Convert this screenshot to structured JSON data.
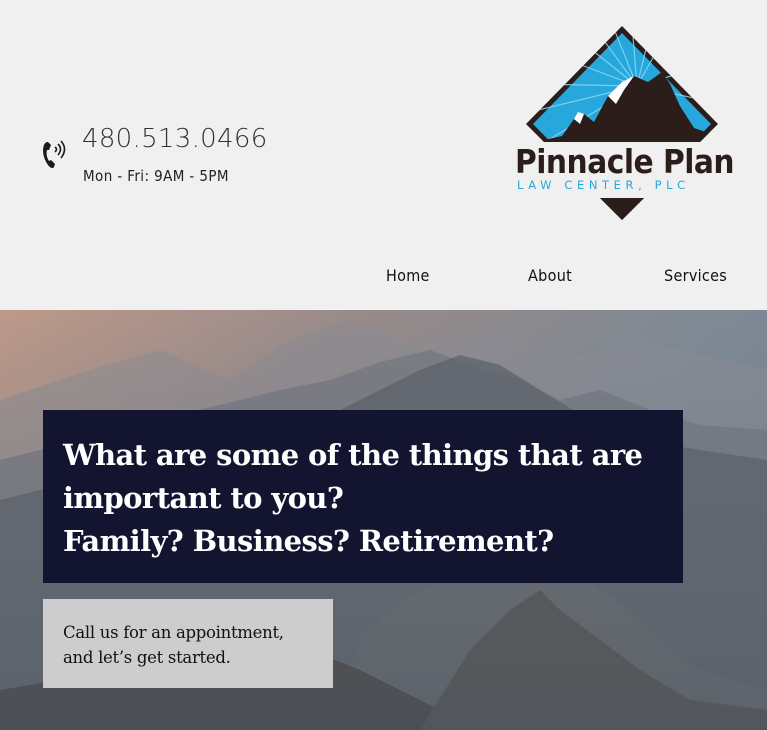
{
  "contact": {
    "phone_icon": "phone-icon",
    "phone": "480.513.0466",
    "hours": "Mon - Fri: 9AM - 5PM"
  },
  "logo": {
    "name": "Pinnacle Plan",
    "subtitle": "LAW CENTER, PLC",
    "colors": {
      "sky": "#27a8dd",
      "mountain": "#2b1d19"
    }
  },
  "nav": {
    "items": [
      "Home",
      "About",
      "Services"
    ]
  },
  "hero": {
    "headline": [
      "What are some of the things that are",
      "important to you?",
      "Family? Business? Retirement?"
    ],
    "cta": [
      "Call us for an appointment,",
      "and let’s get started."
    ],
    "colors": {
      "headline_bg": "#13142f",
      "cta_bg": "#cdcdcd"
    }
  }
}
